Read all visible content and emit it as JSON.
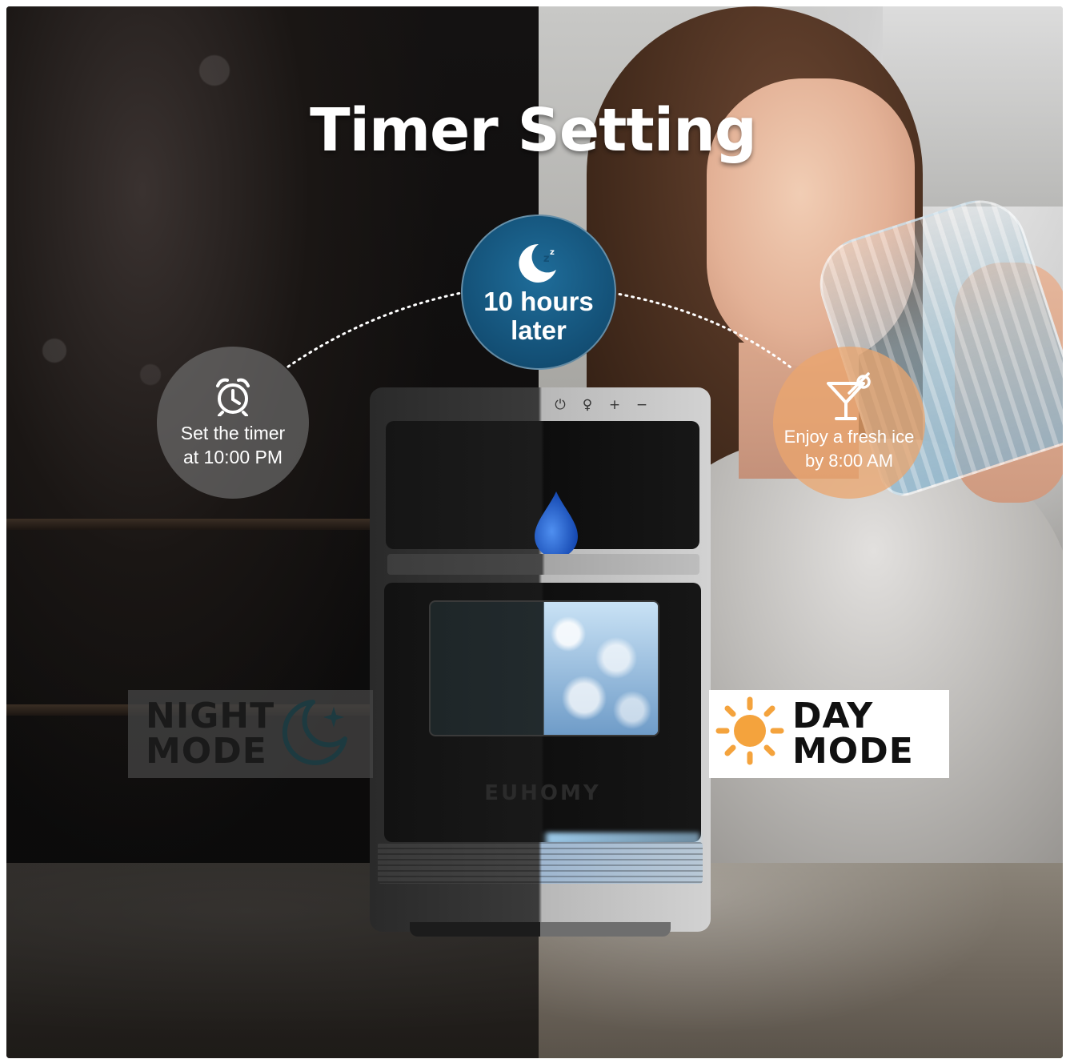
{
  "title": "Timer Setting",
  "steps": {
    "start": {
      "line1": "Set the timer",
      "line2": "at 10:00 PM",
      "icon": "alarm-clock-icon"
    },
    "wait": {
      "line1": "10 hours",
      "line2": "later",
      "icon": "moon-sleep-icon"
    },
    "end": {
      "line1": "Enjoy a fresh ice",
      "line2": "by 8:00 AM",
      "icon": "cocktail-glass-icon"
    }
  },
  "modes": {
    "night": {
      "line1": "NIGHT",
      "line2": "MODE",
      "icon": "moon-stars-icon",
      "color": "#1d3a40"
    },
    "day": {
      "line1": "DAY",
      "line2": "MODE",
      "icon": "sun-icon",
      "color": "#f0a03c"
    }
  },
  "product": {
    "brand": "EUHOMY",
    "controls": [
      "⏻",
      "♀",
      "+",
      "−"
    ]
  },
  "colors": {
    "wait_bubble": "#134f75",
    "day_bubble": "#eba56e",
    "water_drop": "#1f5fd1"
  }
}
